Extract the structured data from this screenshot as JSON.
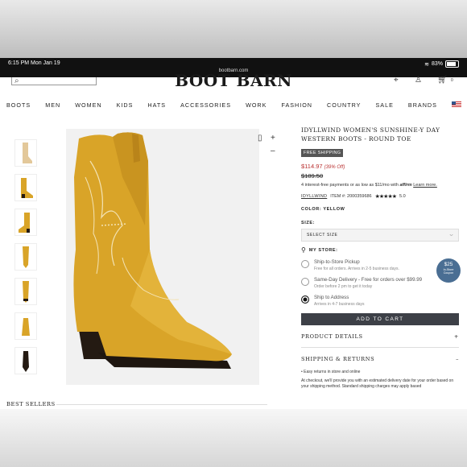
{
  "status_bar": {
    "time": "6:15 PM   Mon Jan 19",
    "url": "bootbarn.com",
    "battery": "83%"
  },
  "header": {
    "logo": "BOOT BARN",
    "cart_count": "0"
  },
  "nav": [
    "BOOTS",
    "MEN",
    "WOMEN",
    "KIDS",
    "HATS",
    "ACCESSORIES",
    "WORK",
    "FASHION",
    "COUNTRY",
    "SALE",
    "BRANDS"
  ],
  "product": {
    "title": "IDYLLWIND WOMEN'S SUNSHINE-Y DAY WESTERN BOOTS - ROUND TOE",
    "badge": "FREE SHIPPING",
    "price": "$114.97",
    "discount": "(39% Off)",
    "original_price": "$189.50",
    "financing_pre": "4 interest-free payments or as low as $11/mo with",
    "financing_brand": "affirm",
    "learn_more": "Learn more.",
    "brand": "IDYLLWIND",
    "item": "ITEM #: 2000359686",
    "stars": "★★★★★",
    "rating": "5.0",
    "color": "COLOR: YELLOW",
    "size_label": "SIZE:",
    "size_placeholder": "SELECT SIZE"
  },
  "store": {
    "label": "MY STORE:",
    "options": [
      {
        "title": "Ship-to-Store Pickup",
        "sub": "Free for all orders. Arrives in 2-5 business days."
      },
      {
        "title": "Same-Day Delivery - Free for orders over $99.99",
        "sub": "Order before 2 pm to get it today"
      },
      {
        "title": "Ship to Address",
        "sub": "Arrives in 4-7 business days"
      }
    ]
  },
  "coupon": {
    "amount": "$25",
    "line1": "In-Store",
    "line2": "Coupon"
  },
  "add_to_cart": "ADD TO CART",
  "accordions": [
    {
      "label": "PRODUCT DETAILS",
      "icon": "+"
    },
    {
      "label": "SHIPPING & RETURNS",
      "icon": "–"
    }
  ],
  "shipping": {
    "bullet": "Easy returns in store and online",
    "text": "At checkout, we'll provide you with an estimated delivery date for your order based on your shipping method. Standard shipping charges may apply based"
  },
  "best_sellers": "BEST SELLERS",
  "colors": {
    "boot": "#d9a428",
    "boot_dark": "#b9841a",
    "heel": "#241a12",
    "button": "#3d4047",
    "sale": "#b93030"
  }
}
